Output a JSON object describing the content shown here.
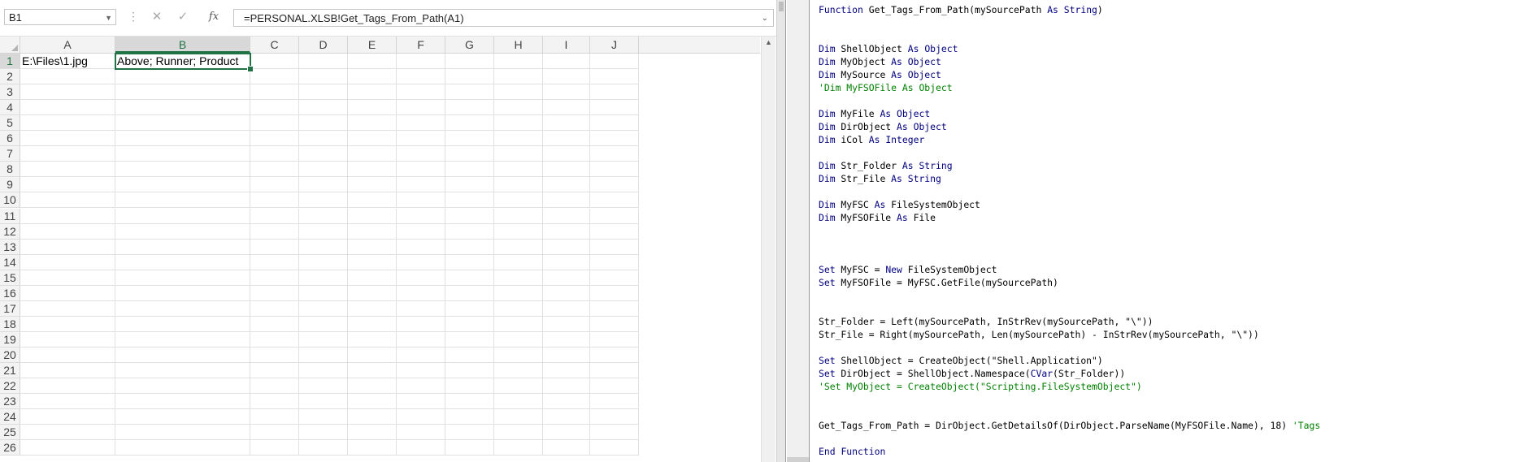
{
  "excel": {
    "name_box": "B1",
    "formula": "=PERSONAL.XLSB!Get_Tags_From_Path(A1)",
    "fx_label": "fx",
    "cancel_glyph": "✕",
    "enter_glyph": "✓",
    "columns": [
      "A",
      "B",
      "C",
      "D",
      "E",
      "F",
      "G",
      "H",
      "I",
      "J"
    ],
    "rows": [
      "1",
      "2",
      "3",
      "4",
      "5",
      "6",
      "7",
      "8",
      "9",
      "10",
      "11",
      "12",
      "13",
      "14",
      "15",
      "16",
      "17",
      "18",
      "19",
      "20",
      "21",
      "22",
      "23",
      "24",
      "25",
      "26"
    ],
    "cells": {
      "A1": "E:\\Files\\1.jpg",
      "B1": "Above; Runner; Product"
    },
    "selected_cell": "B1",
    "accent_color": "#217346"
  },
  "vba": {
    "lines": [
      [
        [
          "kw",
          "Function"
        ],
        [
          "t",
          " Get_Tags_From_Path(mySourcePath "
        ],
        [
          "kw",
          "As"
        ],
        [
          "t",
          " "
        ],
        [
          "kw",
          "String"
        ],
        [
          "t",
          ")"
        ]
      ],
      [],
      [],
      [
        [
          "kw",
          "Dim"
        ],
        [
          "t",
          " ShellObject "
        ],
        [
          "kw",
          "As"
        ],
        [
          "t",
          " "
        ],
        [
          "kw",
          "Object"
        ]
      ],
      [
        [
          "kw",
          "Dim"
        ],
        [
          "t",
          " MyObject "
        ],
        [
          "kw",
          "As"
        ],
        [
          "t",
          " "
        ],
        [
          "kw",
          "Object"
        ]
      ],
      [
        [
          "kw",
          "Dim"
        ],
        [
          "t",
          " MySource "
        ],
        [
          "kw",
          "As"
        ],
        [
          "t",
          " "
        ],
        [
          "kw",
          "Object"
        ]
      ],
      [
        [
          "cm",
          "'Dim MyFSOFile As Object"
        ]
      ],
      [],
      [
        [
          "kw",
          "Dim"
        ],
        [
          "t",
          " MyFile "
        ],
        [
          "kw",
          "As"
        ],
        [
          "t",
          " "
        ],
        [
          "kw",
          "Object"
        ]
      ],
      [
        [
          "kw",
          "Dim"
        ],
        [
          "t",
          " DirObject "
        ],
        [
          "kw",
          "As"
        ],
        [
          "t",
          " "
        ],
        [
          "kw",
          "Object"
        ]
      ],
      [
        [
          "kw",
          "Dim"
        ],
        [
          "t",
          " iCol "
        ],
        [
          "kw",
          "As"
        ],
        [
          "t",
          " "
        ],
        [
          "kw",
          "Integer"
        ]
      ],
      [],
      [
        [
          "kw",
          "Dim"
        ],
        [
          "t",
          " Str_Folder "
        ],
        [
          "kw",
          "As"
        ],
        [
          "t",
          " "
        ],
        [
          "kw",
          "String"
        ]
      ],
      [
        [
          "kw",
          "Dim"
        ],
        [
          "t",
          " Str_File "
        ],
        [
          "kw",
          "As"
        ],
        [
          "t",
          " "
        ],
        [
          "kw",
          "String"
        ]
      ],
      [],
      [
        [
          "kw",
          "Dim"
        ],
        [
          "t",
          " MyFSC "
        ],
        [
          "kw",
          "As"
        ],
        [
          "t",
          " FileSystemObject"
        ]
      ],
      [
        [
          "kw",
          "Dim"
        ],
        [
          "t",
          " MyFSOFile "
        ],
        [
          "kw",
          "As"
        ],
        [
          "t",
          " File"
        ]
      ],
      [],
      [],
      [],
      [
        [
          "kw",
          "Set"
        ],
        [
          "t",
          " MyFSC = "
        ],
        [
          "kw",
          "New"
        ],
        [
          "t",
          " FileSystemObject"
        ]
      ],
      [
        [
          "kw",
          "Set"
        ],
        [
          "t",
          " MyFSOFile = MyFSC.GetFile(mySourcePath)"
        ]
      ],
      [],
      [],
      [
        [
          "t",
          "Str_Folder = Left(mySourcePath, InStrRev(mySourcePath, \"\\\"))"
        ]
      ],
      [
        [
          "t",
          "Str_File = Right(mySourcePath, Len(mySourcePath) - InStrRev(mySourcePath, \"\\\"))"
        ]
      ],
      [],
      [
        [
          "kw",
          "Set"
        ],
        [
          "t",
          " ShellObject = CreateObject(\"Shell.Application\")"
        ]
      ],
      [
        [
          "kw",
          "Set"
        ],
        [
          "t",
          " DirObject = ShellObject.Namespace("
        ],
        [
          "kw",
          "CVar"
        ],
        [
          "t",
          "(Str_Folder))"
        ]
      ],
      [
        [
          "cm",
          "'Set MyObject = CreateObject(\"Scripting.FileSystemObject\")"
        ]
      ],
      [],
      [],
      [
        [
          "t",
          "Get_Tags_From_Path = DirObject.GetDetailsOf(DirObject.ParseName(MyFSOFile.Name), 18) "
        ],
        [
          "cm",
          "'Tags"
        ]
      ],
      [],
      [
        [
          "kw",
          "End"
        ],
        [
          "t",
          " "
        ],
        [
          "kw",
          "Function"
        ]
      ]
    ]
  }
}
